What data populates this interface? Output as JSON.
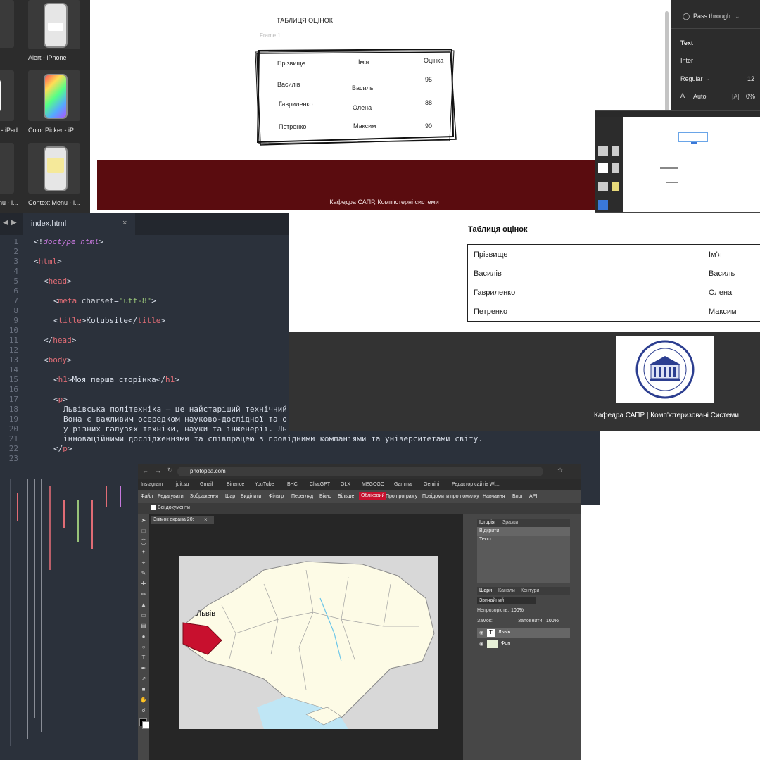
{
  "figma": {
    "assets": [
      {
        "label": "Alert - iPhone"
      },
      {
        "label": "r - iPad"
      },
      {
        "label": "Color Picker - iP..."
      },
      {
        "label": "nu - i..."
      },
      {
        "label": "Context Menu - i..."
      }
    ],
    "canvas": {
      "heading": "ТАБЛИЦЯ ОЦІНОК",
      "frame_label": "Frame 1",
      "sketch_table": {
        "headers": [
          "Прізвище",
          "Ім'я",
          "Оцінка"
        ],
        "rows": [
          [
            "Василів",
            "Василь",
            "95"
          ],
          [
            "Гавриленко",
            "Олена",
            "88"
          ],
          [
            "Петренко",
            "Максим",
            "90"
          ]
        ]
      },
      "footer_text": "Кафедра САПР, Комп'ютерні системи"
    },
    "props": {
      "blend": "Pass through",
      "section_text": "Text",
      "font": "Inter",
      "weight": "Regular",
      "size": "12",
      "auto": "Auto",
      "letter_spacing": "0%"
    }
  },
  "editor": {
    "tab": "index.html",
    "line_numbers": [
      "1",
      "2",
      "3",
      "4",
      "5",
      "6",
      "7",
      "8",
      "9",
      "10",
      "11",
      "12",
      "13",
      "14",
      "15",
      "16",
      "17",
      "18",
      "19",
      "20",
      "21",
      "22",
      "23"
    ],
    "doctype": "doctype",
    "doctype_val": "html",
    "t_html": "html",
    "t_head": "head",
    "t_meta": "meta",
    "a_charset": "charset",
    "v_charset": "\"utf-8\"",
    "t_title": "title",
    "title_text": "Kotubsite",
    "t_body": "body",
    "t_h1": "h1",
    "h1_text": "Моя перша сторінка",
    "t_p": "p",
    "p_line1": "Львівська політехніка — це найстаріший технічний",
    "p_line2": "Вона є важливим осередком науково-дослідної та о",
    "p_line3": "у різних галузях техніки, науки та інженерії. Ль",
    "p_line4": "інноваційними дослідженнями та співпрацею з провідними компаніями та університетами світу."
  },
  "webpage": {
    "heading": "Таблиця оцінок",
    "table": {
      "rows": [
        [
          "Прізвище",
          "Ім'я"
        ],
        [
          "Василів",
          "Василь"
        ],
        [
          "Гавриленко",
          "Олена"
        ],
        [
          "Петренко",
          "Максим"
        ]
      ]
    },
    "footer_text": "Кафедра САПР | Комп'ютеризовані Системи"
  },
  "browser": {
    "url": "photopea.com",
    "bookmarks": [
      "Instagram",
      "juit.su",
      "Gmail",
      "Binance",
      "YouTube",
      "BHC",
      "ChatGPT",
      "OLX",
      "MEGOGO",
      "Gamma",
      "Gemini",
      "Редактор сайтів Wi..."
    ],
    "menu": [
      "Файл",
      "Редагувати",
      "Зображення",
      "Шар",
      "Виділити",
      "Фільтр",
      "Перегляд",
      "Вікно",
      "Більше",
      "Обліковий",
      "Про програму",
      "Повідомити про помилку",
      "Навчання",
      "Блог",
      "API"
    ],
    "option_all_docs": "Всі документи",
    "doc_tab": "Знімок екрана 20:",
    "map_label": "Львів",
    "history_tabs": [
      "Історія",
      "Зразки"
    ],
    "history_items": [
      "Відкрити",
      "Текст"
    ],
    "layer_tabs": [
      "Шари",
      "Канали",
      "Контури"
    ],
    "blend_mode": "Звичайний",
    "opacity_label": "Непрозорість:",
    "opacity_value": "100%",
    "lock_label": "Замок:",
    "fill_label": "Заповнити:",
    "fill_value": "100%",
    "layers": [
      "Львів",
      "Фон"
    ],
    "colors": {
      "accent_red": "#c8102e",
      "footer_maroon": "#5a0c0f"
    }
  }
}
